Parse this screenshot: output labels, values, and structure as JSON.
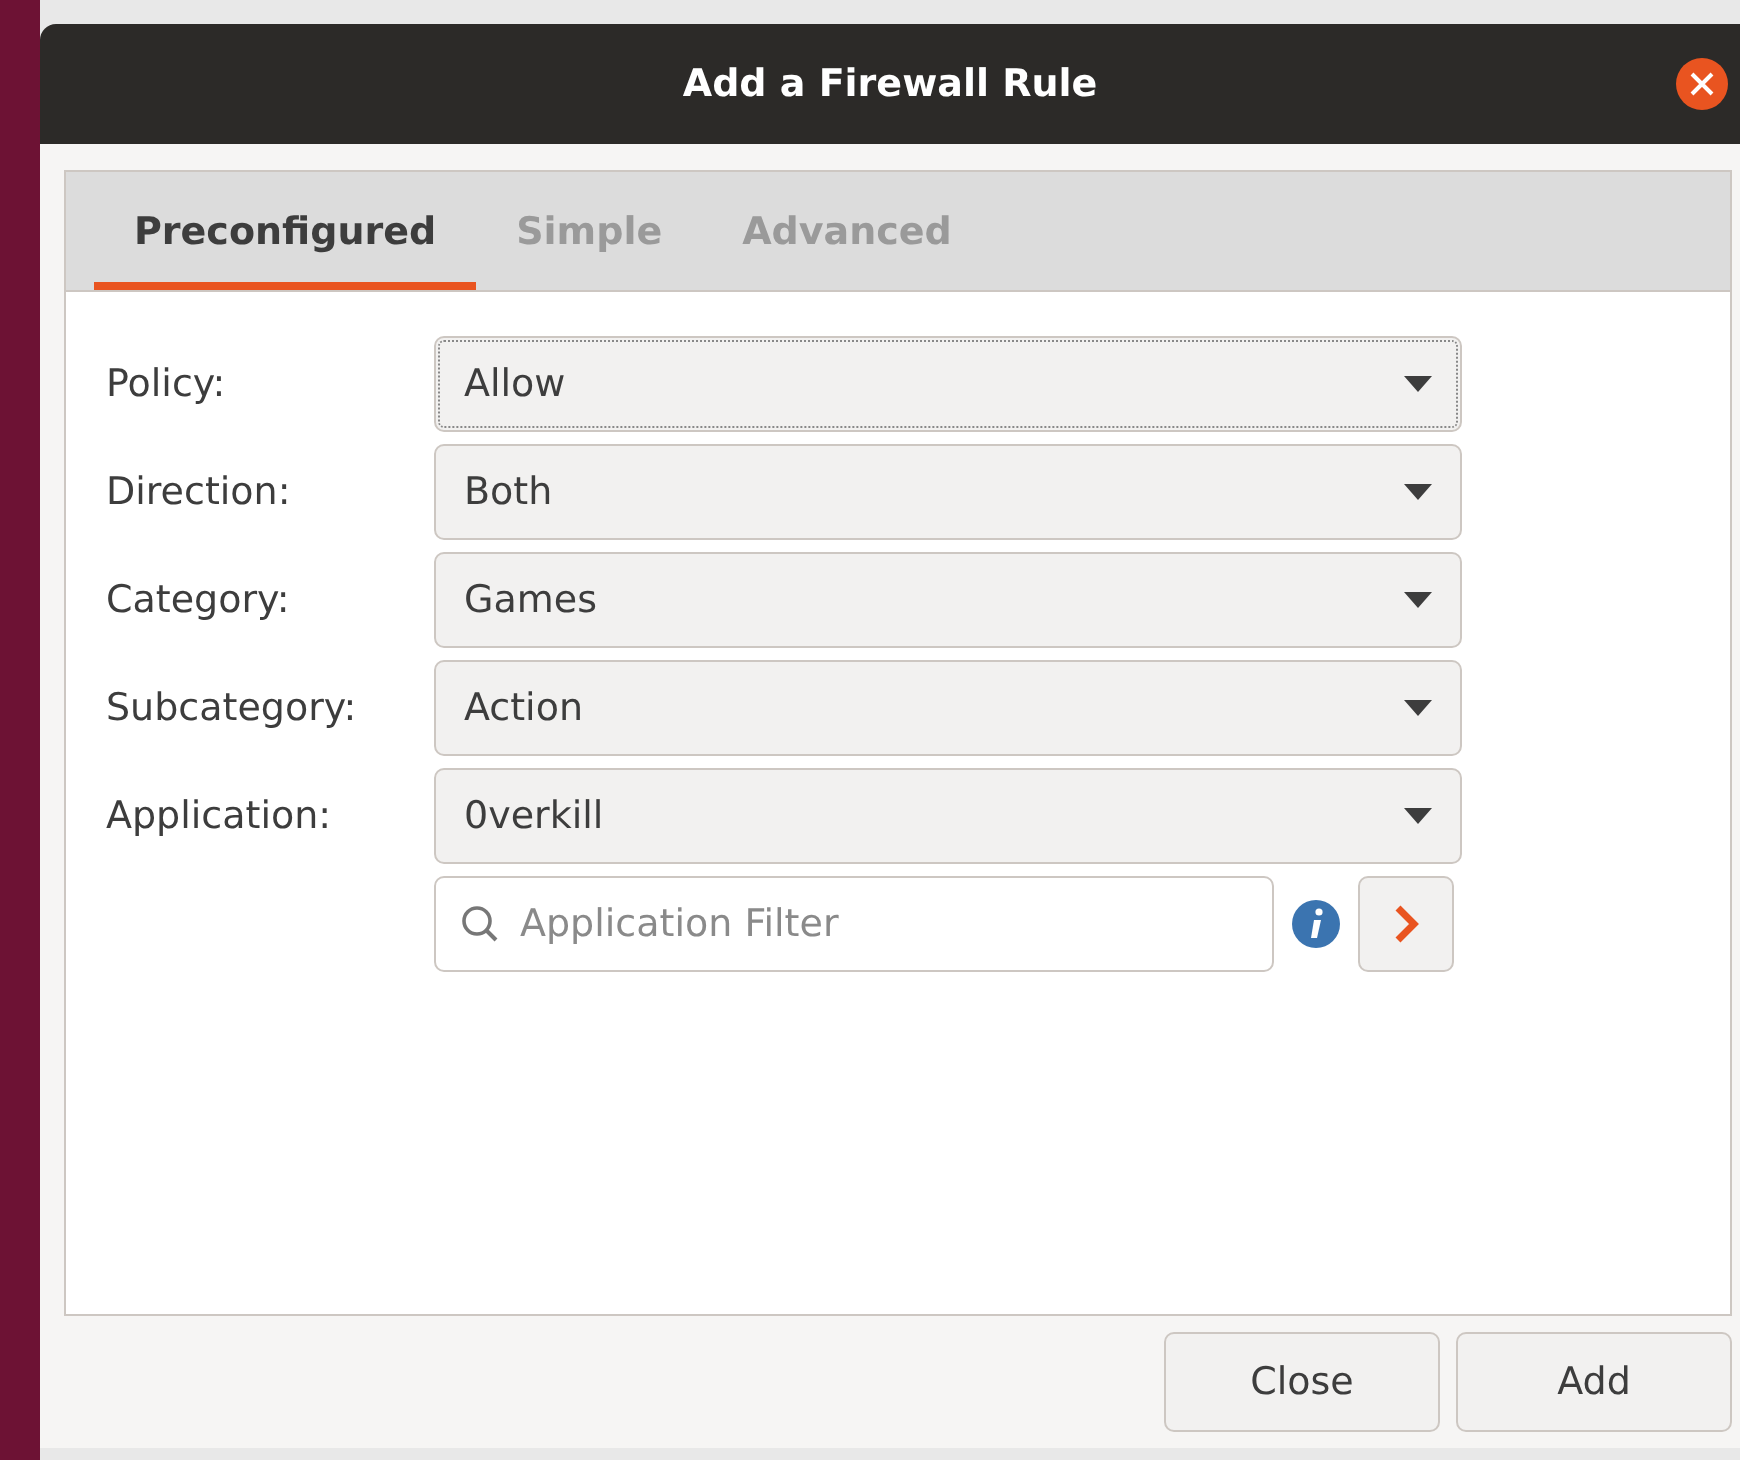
{
  "window": {
    "title": "Add a Firewall Rule"
  },
  "tabs": [
    {
      "label": "Preconfigured",
      "selected": true
    },
    {
      "label": "Simple",
      "selected": false
    },
    {
      "label": "Advanced",
      "selected": false
    }
  ],
  "fields": [
    {
      "label": "Policy:",
      "value": "Allow",
      "focused": true
    },
    {
      "label": "Direction:",
      "value": "Both",
      "focused": false
    },
    {
      "label": "Category:",
      "value": "Games",
      "focused": false
    },
    {
      "label": "Subcategory:",
      "value": "Action",
      "focused": false
    },
    {
      "label": "Application:",
      "value": "0verkill",
      "focused": false
    }
  ],
  "filter": {
    "placeholder": "Application Filter"
  },
  "buttons": [
    "Close",
    "Add"
  ]
}
